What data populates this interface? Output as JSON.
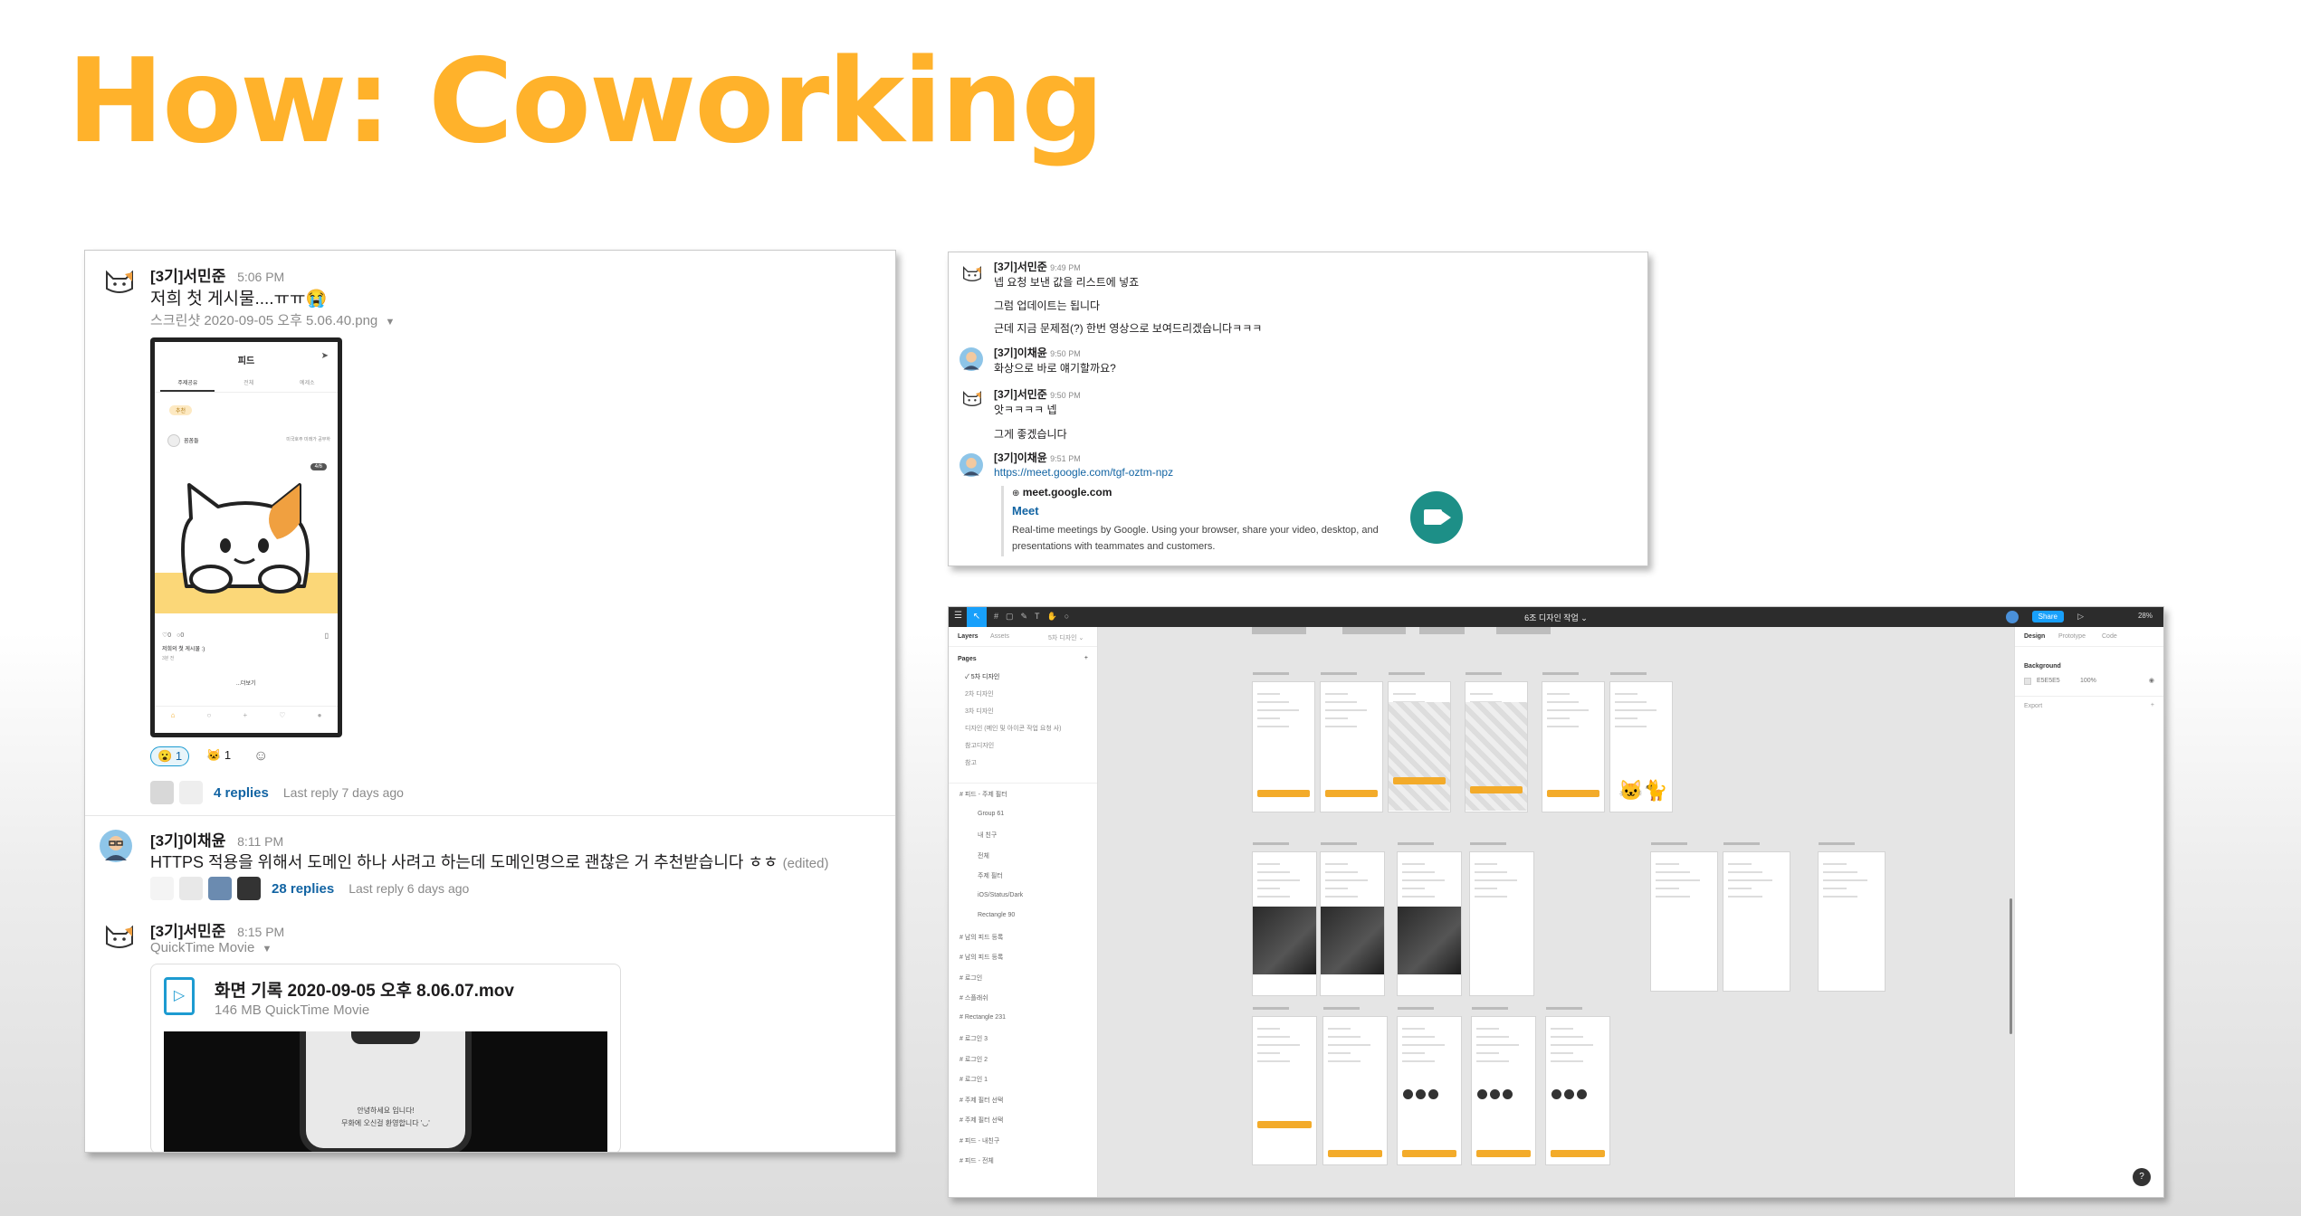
{
  "slide": {
    "title": "How: Coworking",
    "title_color": "#ffb22b"
  },
  "slack": {
    "msg1": {
      "author": "[3기]서민준",
      "time": "5:06 PM",
      "text": "저희 첫 게시물....ㅠㅠ😭",
      "attachment": "스크린샷 2020-09-05 오후 5.06.40.png",
      "phone": {
        "header": "피드",
        "tabs": [
          "주제공유",
          "전체",
          "예제소"
        ],
        "chip": "추천",
        "username": "꼼꼼들",
        "meta": "미국호주 미래가 공부하",
        "badge": "4/6",
        "likes": "♡0",
        "comments": "○0",
        "caption": "저희의 첫 게시물 :)",
        "caption_time": "3분 전",
        "more": "...더보기"
      },
      "reactions": [
        {
          "emoji": "😮",
          "count": "1"
        },
        {
          "emoji": "🐱",
          "count": "1"
        }
      ],
      "replies": "4 replies",
      "last_reply": "Last reply 7 days ago"
    },
    "msg2": {
      "author": "[3기]이채윤",
      "time": "8:11 PM",
      "text": "HTTPS 적용을 위해서 도메인 하나 사려고 하는데 도메인명으로 괜찮은 거 추천받습니다 ㅎㅎ",
      "edited": "(edited)",
      "replies": "28 replies",
      "last_reply": "Last reply 6 days ago"
    },
    "msg3": {
      "author": "[3기]서민준",
      "time": "8:15 PM",
      "file_type_label": "QuickTime Movie",
      "file_name": "화면 기록 2020-09-05 오후 8.06.07.mov",
      "file_meta": "146 MB QuickTime Movie",
      "video_text": "안녕하세요 입니다!",
      "video_text2": "무화에 오신걸 환영합니다 '◡'"
    }
  },
  "chat": {
    "m1": {
      "author": "[3기]서민준",
      "time": "9:49 PM",
      "lines": [
        "넵 요청 보낸 값을 리스트에 넣죠",
        "그럼 업데이트는 됩니다",
        "근데 지금 문제점(?) 한번 영상으로 보여드리겠습니다ㅋㅋㅋ"
      ]
    },
    "m2": {
      "author": "[3기]이채윤",
      "time": "9:50 PM",
      "lines": [
        "화상으로 바로 얘기할까요?"
      ]
    },
    "m3": {
      "author": "[3기]서민준",
      "time": "9:50 PM",
      "lines": [
        "앗ㅋㅋㅋㅋ 넵",
        "그게 좋겠습니다"
      ]
    },
    "m4": {
      "author": "[3기]이채윤",
      "time": "9:51 PM",
      "link": "https://meet.google.com/tgf-oztm-npz"
    },
    "preview": {
      "site": "meet.google.com",
      "title": "Meet",
      "desc": "Real-time meetings by Google. Using your browser, share your video, desktop, and presentations with teammates and customers."
    }
  },
  "figma": {
    "file_title": "6조 디자인 작업 ⌄",
    "share": "Share",
    "zoom": "28%",
    "tabs": {
      "layers": "Layers",
      "assets": "Assets",
      "page_sel": "5차 디자인 ⌄"
    },
    "right_tabs": [
      "Design",
      "Prototype",
      "Code"
    ],
    "background_label": "Background",
    "bg_hex": "E5E5E5",
    "bg_opacity": "100%",
    "export_label": "Export",
    "pages_label": "Pages",
    "pages": [
      "5차 디자인",
      "2차 디자인",
      "3차 디자인",
      "디자인 (메인 및 아이콘 작업 요청 사)",
      "참고디자인",
      "참고"
    ],
    "layers": [
      "피드 - 주제 필터",
      "Group 61",
      "내 친구",
      "전체",
      "주제 필터",
      "iOS/Status/Dark",
      "Rectangle 90",
      "남의 피드 등록",
      "남의 피드 등록",
      "로그인",
      "스플래쉬",
      "Rectangle 231",
      "로그인 3",
      "로그인 2",
      "로그인 1",
      "주제 필터 선택",
      "주제 필터 선택",
      "피드 - 내친구",
      "피드 - 전체"
    ]
  }
}
